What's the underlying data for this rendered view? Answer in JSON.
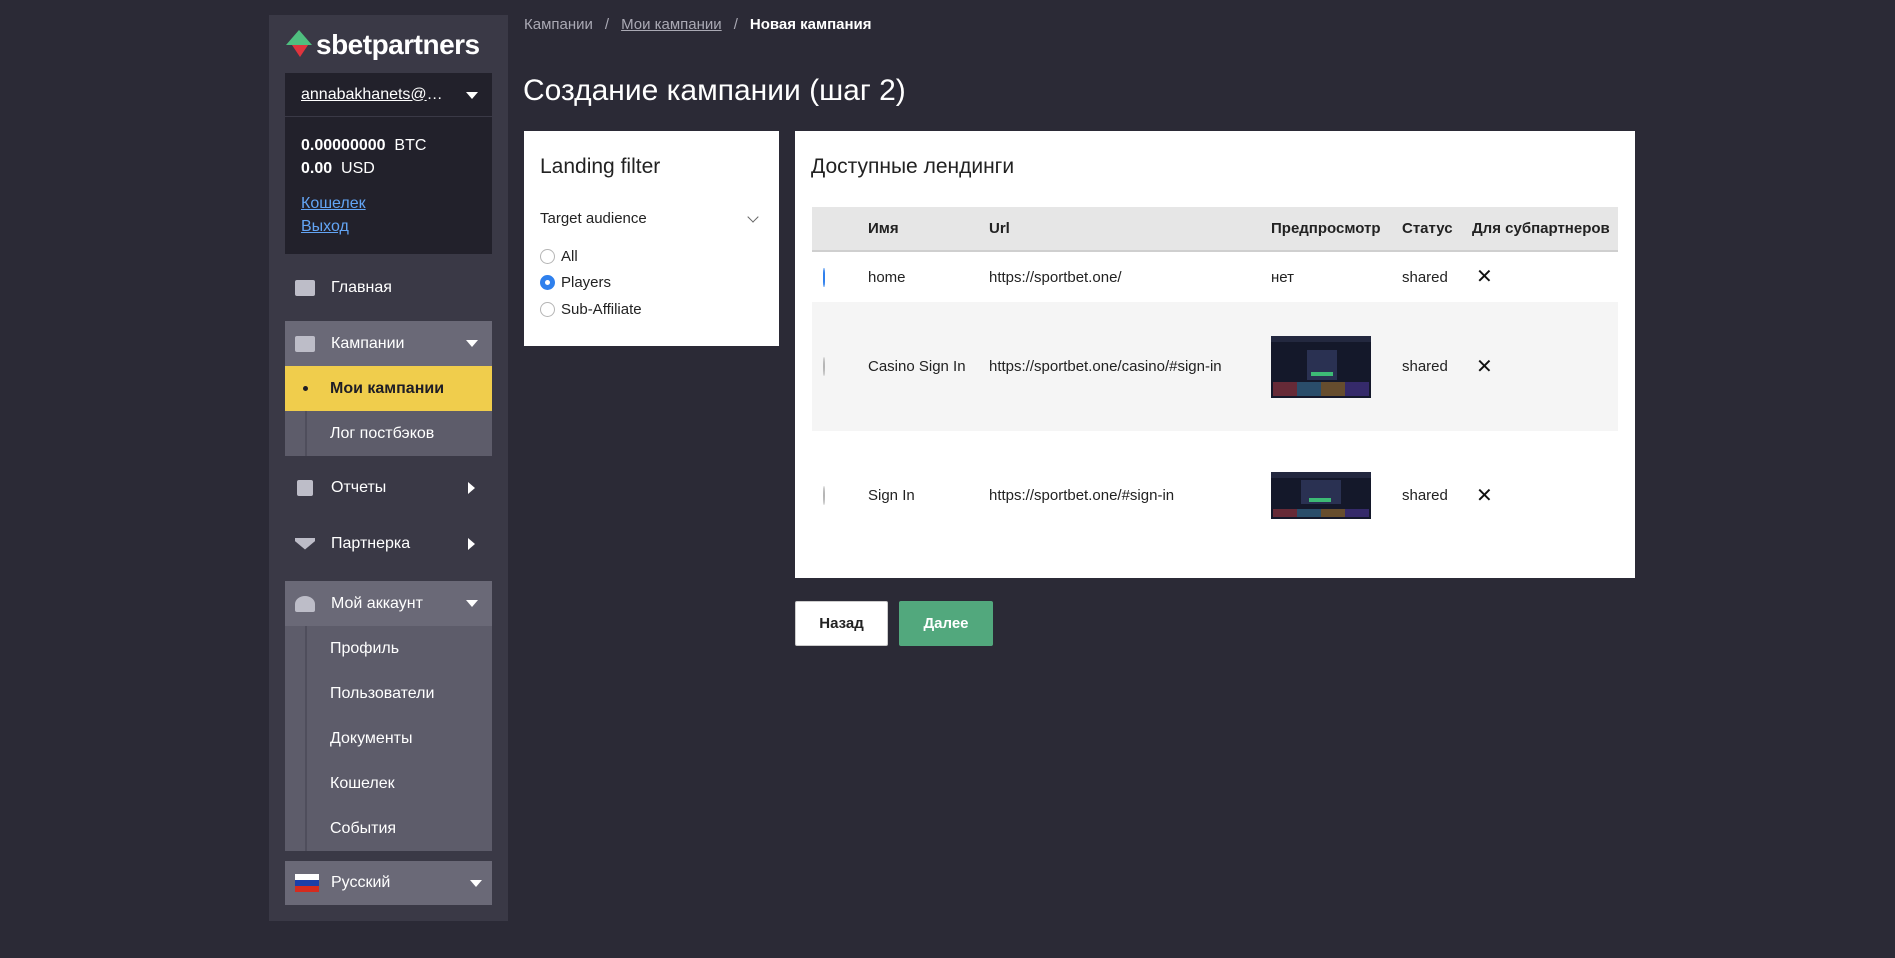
{
  "brand": {
    "name": "sbetpartners"
  },
  "account": {
    "email": "annabakhanets@g...",
    "balances": [
      {
        "amount": "0.00000000",
        "currency": "BTC"
      },
      {
        "amount": "0.00",
        "currency": "USD"
      }
    ],
    "wallet_link": "Кошелек",
    "logout_link": "Выход"
  },
  "nav": {
    "home": "Главная",
    "campaigns": "Кампании",
    "my_campaigns": "Мои кампании",
    "postback_log": "Лог постбэков",
    "reports": "Отчеты",
    "partnership": "Партнерка",
    "my_account": "Мой аккаунт",
    "profile": "Профиль",
    "users": "Пользователи",
    "documents": "Документы",
    "wallet": "Кошелек",
    "events": "События",
    "language": "Русский"
  },
  "breadcrumb": {
    "root": "Кампании",
    "parent": "Мои кампании",
    "current": "Новая кампания",
    "separator": "/"
  },
  "page_title": "Создание кампании (шаг 2)",
  "filter": {
    "title": "Landing filter",
    "target_label": "Target audience",
    "options": [
      "All",
      "Players",
      "Sub-Affiliate"
    ],
    "selected": "Players"
  },
  "landings": {
    "title": "Доступные лендинги",
    "columns": [
      "Имя",
      "Url",
      "Предпросмотр",
      "Статус",
      "Для субпартнеров"
    ],
    "rows": [
      {
        "name": "home",
        "url": "https://sportbet.one/",
        "preview": "нет",
        "status": "shared",
        "selected": true
      },
      {
        "name": "Casino Sign In",
        "url": "https://sportbet.one/casino/#sign-in",
        "preview": "",
        "status": "shared",
        "selected": false
      },
      {
        "name": "Sign In",
        "url": "https://sportbet.one/#sign-in",
        "preview": "",
        "status": "shared",
        "selected": false
      }
    ]
  },
  "buttons": {
    "back": "Назад",
    "next": "Далее"
  },
  "colors": {
    "accent_yellow": "#f0cd4c",
    "next_green": "#52a87d",
    "link_blue": "#63a5f5"
  }
}
